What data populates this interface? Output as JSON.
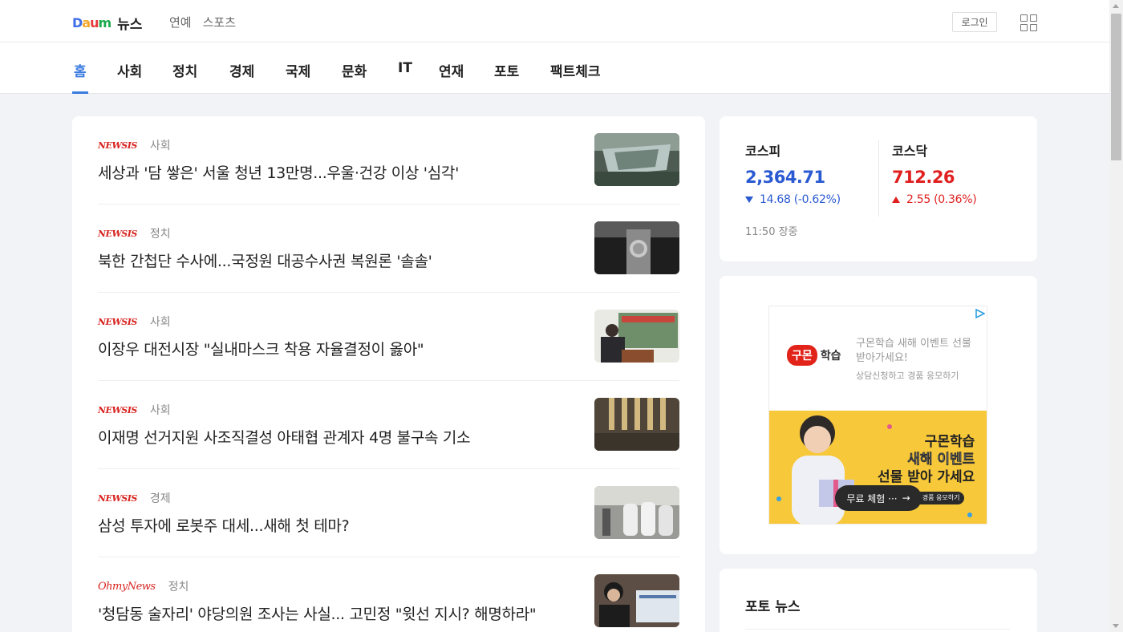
{
  "header": {
    "logo_text": "Daum",
    "logo_colors": [
      "#3d6de8",
      "#f5a623",
      "#e8393a",
      "#1aa94b",
      "#3d6de8"
    ],
    "service_name": "뉴스",
    "top_links": [
      "연예",
      "스포츠"
    ],
    "login_label": "로그인",
    "apps_icon": "grid-icon"
  },
  "nav": {
    "tabs": [
      "홈",
      "사회",
      "정치",
      "경제",
      "국제",
      "문화",
      "IT",
      "연재",
      "포토",
      "팩트체크"
    ],
    "active_index": 0
  },
  "news": [
    {
      "source": "NEWSIS",
      "category": "사회",
      "headline": "세상과 '담 쌓은' 서울 청년 13만명...우울·건강 이상 '심각'"
    },
    {
      "source": "NEWSIS",
      "category": "정치",
      "headline": "북한 간첩단 수사에...국정원 대공수사권 복원론 '솔솔'"
    },
    {
      "source": "NEWSIS",
      "category": "사회",
      "headline": "이장우 대전시장 \"실내마스크 착용 자율결정이 옳아\""
    },
    {
      "source": "NEWSIS",
      "category": "사회",
      "headline": "이재명 선거지원 사조직결성 아태협 관계자 4명 불구속 기소"
    },
    {
      "source": "NEWSIS",
      "category": "경제",
      "headline": "삼성 투자에 로봇주 대세...새해 첫 테마?"
    },
    {
      "source": "OhmyNews",
      "category": "정치",
      "headline": "'청담동 술자리' 야당의원 조사는 사실... 고민정 \"윗선 지시? 해명하라\""
    }
  ],
  "stocks": {
    "kospi": {
      "name": "코스피",
      "value": "2,364.71",
      "change": "14.68 (-0.62%)",
      "direction": "down"
    },
    "kosdaq": {
      "name": "코스닥",
      "value": "712.26",
      "change": "2.55 (0.36%)",
      "direction": "up"
    },
    "time": "11:50 장중",
    "colors": {
      "down": "#2a5ad2",
      "up": "#e02020"
    }
  },
  "ad": {
    "brand_badge": "구몬",
    "brand_suffix": "학습",
    "title": "구몬학습 새해 이벤트 선물 받아가세요!",
    "subtitle": "상담신청하고 경품 응모하기",
    "headline_1": "구몬학습",
    "headline_2": "새해 이벤트",
    "headline_3": "선물 받아 가세요",
    "cta": "무료 체험 ···",
    "cta_tail": "l 경품 응모하기"
  },
  "photo_news": {
    "title": "포토 뉴스"
  }
}
